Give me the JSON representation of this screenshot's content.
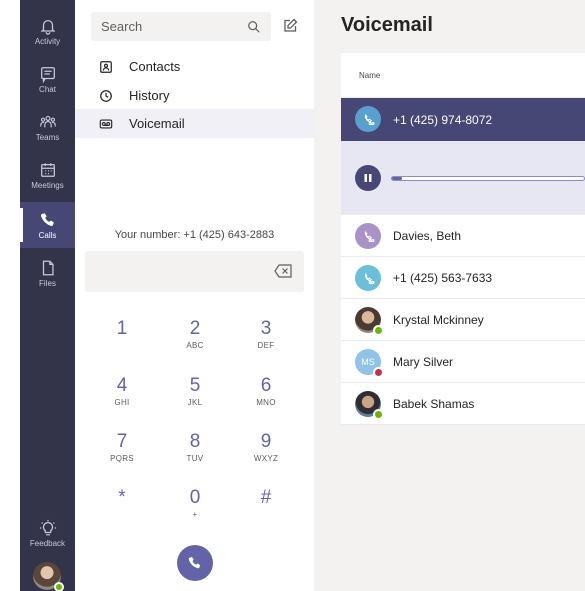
{
  "rail": {
    "items": [
      {
        "label": "Activity",
        "icon": "bell-icon"
      },
      {
        "label": "Chat",
        "icon": "chat-icon"
      },
      {
        "label": "Teams",
        "icon": "teams-icon"
      },
      {
        "label": "Meetings",
        "icon": "calendar-icon"
      },
      {
        "label": "Calls",
        "icon": "phone-icon"
      },
      {
        "label": "Files",
        "icon": "file-icon"
      }
    ],
    "active": "Calls",
    "feedback_label": "Feedback"
  },
  "sidebar": {
    "search_placeholder": "Search",
    "nav": [
      {
        "label": "Contacts",
        "icon": "contacts-icon"
      },
      {
        "label": "History",
        "icon": "history-icon"
      },
      {
        "label": "Voicemail",
        "icon": "voicemail-icon"
      }
    ],
    "selected": "Voicemail"
  },
  "dialpad": {
    "your_number": "Your number: +1 (425) 643-2883",
    "keys": [
      {
        "digit": "1",
        "letters": ""
      },
      {
        "digit": "2",
        "letters": "ABC"
      },
      {
        "digit": "3",
        "letters": "DEF"
      },
      {
        "digit": "4",
        "letters": "GHI"
      },
      {
        "digit": "5",
        "letters": "JKL"
      },
      {
        "digit": "6",
        "letters": "MNO"
      },
      {
        "digit": "7",
        "letters": "PQRS"
      },
      {
        "digit": "8",
        "letters": "TUV"
      },
      {
        "digit": "9",
        "letters": "WXYZ"
      },
      {
        "digit": "*",
        "letters": ""
      },
      {
        "digit": "0",
        "letters": "+"
      },
      {
        "digit": "#",
        "letters": ""
      }
    ]
  },
  "voicemail": {
    "title": "Voicemail",
    "column_name": "Name",
    "playback_progress": 0.05,
    "rows": [
      {
        "name": "+1 (425) 974-8072",
        "avatar": "voicemail-caller-icon",
        "avatar_color": "#5aa0cf",
        "active": true
      },
      {
        "name": "Davies, Beth",
        "avatar": "voicemail-caller-icon",
        "avatar_color": "#a992c7",
        "presence": ""
      },
      {
        "name": "+1 (425) 563-7633",
        "avatar": "voicemail-caller-icon",
        "avatar_color": "#6bbfd9",
        "presence": ""
      },
      {
        "name": "Krystal Mckinney",
        "avatar": "photo",
        "avatar_color": "#6a5a50",
        "presence": "available"
      },
      {
        "name": "Mary Silver",
        "avatar": "MS",
        "avatar_color": "#8fc4e8",
        "presence": "busy"
      },
      {
        "name": "Babek Shamas",
        "avatar": "photo",
        "avatar_color": "#4a6c84",
        "presence": "available"
      }
    ]
  },
  "colors": {
    "rail_bg": "#33344a",
    "accent": "#6264a7",
    "selected_row": "#464775",
    "available": "#6bb700",
    "busy": "#c4314b"
  }
}
